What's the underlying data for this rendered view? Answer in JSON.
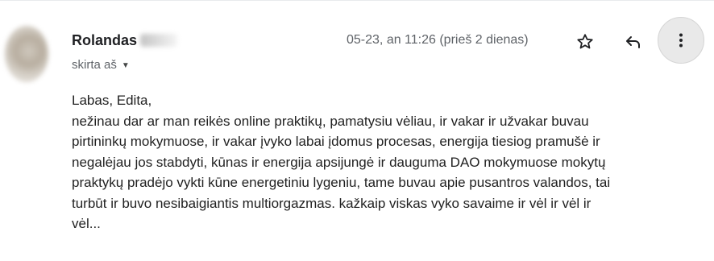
{
  "sender": {
    "name": "Rolandas"
  },
  "recipient": {
    "label": "skirta aš"
  },
  "timestamp": "05-23, an 11:26 (prieš 2 dienas)",
  "icons": {
    "star": "star-icon",
    "reply": "reply-icon",
    "more": "more-vertical-icon",
    "dropdown": "chevron-down-icon"
  },
  "message": {
    "greeting": "Labas, Edita,",
    "lines": [
      "nežinau dar ar man reikės online praktikų, pamatysiu vėliau, ir vakar ir užvakar buvau",
      "pirtininkų mokymuose, ir vakar įvyko labai įdomus procesas, energija tiesiog pramušė ir",
      "negalėjau jos stabdyti, kūnas ir energija apsijungė ir dauguma DAO mokymuose mokytų",
      "praktykų pradėjo vykti kūne energetiniu lygeniu, tame buvau apie pusantros valandos, tai",
      "turbūt ir buvo nesibaigiantis multiorgazmas. kažkaip viskas vyko savaime ir vėl ir vėl ir",
      "vėl..."
    ]
  },
  "colors": {
    "name": "#202124",
    "secondary": "#5f6368",
    "body": "#222222",
    "more_button_bg": "#e9e9e9"
  }
}
